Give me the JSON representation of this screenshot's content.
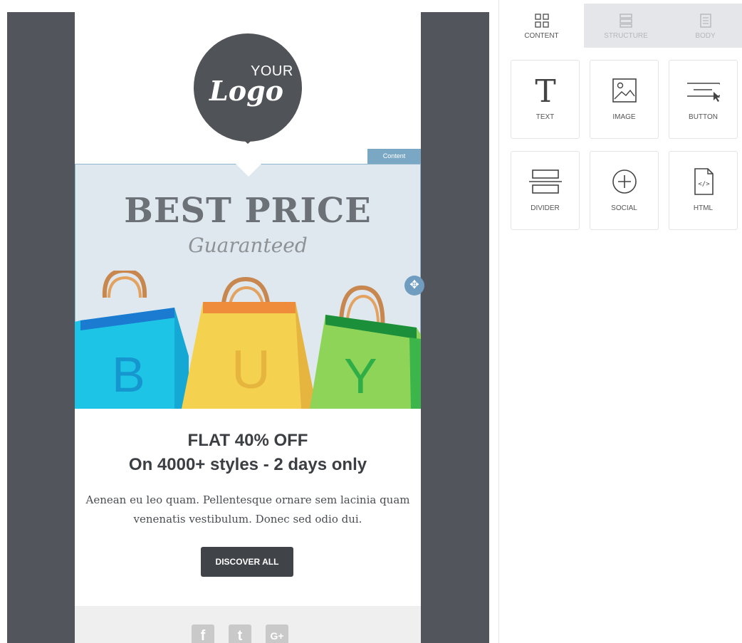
{
  "email": {
    "logo_top": "YOUR",
    "logo_main": "Logo",
    "content_tag": "Content",
    "headline": "BEST PRICE",
    "subheadline": "Guaranteed",
    "bag_letters": [
      "B",
      "U",
      "Y"
    ],
    "offer_line1": "FLAT 40% OFF",
    "offer_line2": "On 4000+ styles - 2 days only",
    "body_text": "Aenean eu leo quam. Pellentesque ornare sem lacinia quam venenatis vestibulum. Donec sed odio dui.",
    "cta_label": "DISCOVER ALL",
    "social": [
      {
        "name": "facebook-icon",
        "glyph": "f"
      },
      {
        "name": "twitter-icon",
        "glyph": "t"
      },
      {
        "name": "google-plus-icon",
        "glyph": "G+"
      }
    ]
  },
  "panel": {
    "tabs": [
      {
        "label": "CONTENT",
        "icon": "grid-icon",
        "active": true
      },
      {
        "label": "STRUCTURE",
        "icon": "rows-icon",
        "active": false
      },
      {
        "label": "BODY",
        "icon": "document-icon",
        "active": false
      }
    ],
    "blocks": [
      {
        "label": "TEXT",
        "icon": "text-icon"
      },
      {
        "label": "IMAGE",
        "icon": "image-icon"
      },
      {
        "label": "BUTTON",
        "icon": "button-icon"
      },
      {
        "label": "DIVIDER",
        "icon": "divider-icon"
      },
      {
        "label": "SOCIAL",
        "icon": "social-plus-icon"
      },
      {
        "label": "HTML",
        "icon": "html-file-icon"
      }
    ]
  },
  "colors": {
    "canvas_bg": "#52555c",
    "banner_bg": "#dfe8ef",
    "accent_blue": "#7aa8c4",
    "dark_button": "#404347"
  }
}
